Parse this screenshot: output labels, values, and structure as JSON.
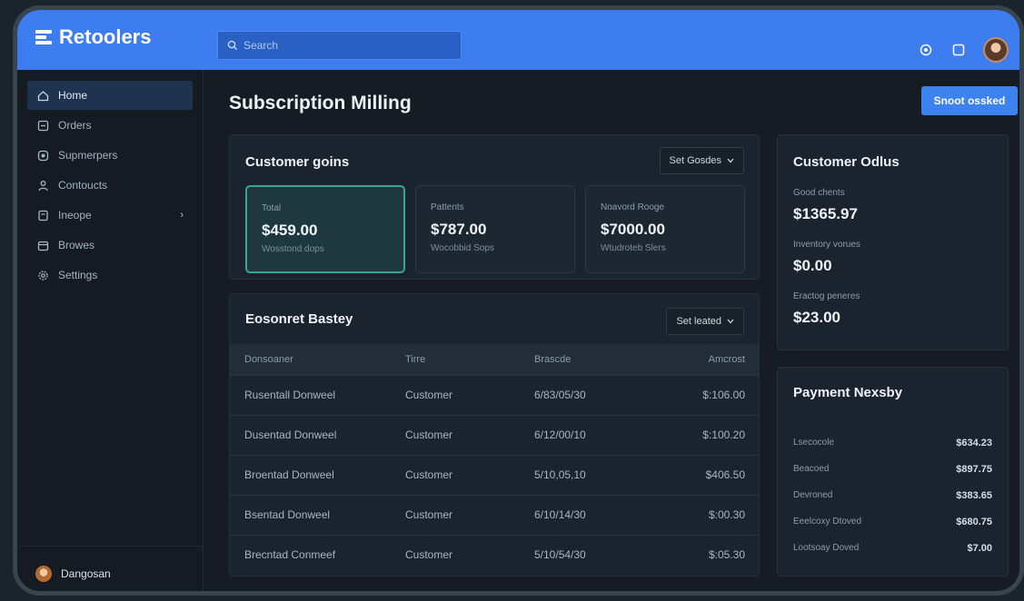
{
  "brand": {
    "name": "Retoolers",
    "icon": "menu-icon"
  },
  "search": {
    "placeholder": "Search",
    "icon": "search-icon"
  },
  "topbar_icons": [
    "settings-icon",
    "window-icon",
    "avatar"
  ],
  "sidebar": {
    "items": [
      {
        "label": "Home",
        "icon": "home-icon",
        "active": true
      },
      {
        "label": "Orders",
        "icon": "orders-icon"
      },
      {
        "label": "Supmerpers",
        "icon": "circle-icon"
      },
      {
        "label": "Contoucts",
        "icon": "user-icon"
      },
      {
        "label": "Ineope",
        "icon": "file-icon",
        "chevron": "›"
      },
      {
        "label": "Browes",
        "icon": "calendar-icon"
      },
      {
        "label": "Settings",
        "icon": "gear-icon"
      }
    ],
    "user": {
      "name": "Dangosan"
    }
  },
  "page": {
    "title": "Subscription Milling",
    "action_label": "Snoot ossked"
  },
  "customer_goals": {
    "title": "Customer goins",
    "select_label": "Set Gosdes",
    "stats": [
      {
        "label": "Total",
        "value": "$459.00",
        "sub": "Wosstond dops"
      },
      {
        "label": "Pattents",
        "value": "$787.00",
        "sub": "Wocobbid Sops"
      },
      {
        "label": "Noavord Rooge",
        "value": "$7000.00",
        "sub": "Wtudroteb Slers"
      }
    ]
  },
  "history": {
    "title": "Eosonret Bastey",
    "select_label": "Set leated",
    "columns": [
      "Donsoaner",
      "Tirre",
      "Brascde",
      "Amcrost"
    ],
    "rows": [
      [
        "Rusentall Donweel",
        "Customer",
        "6/83/05/30",
        "$:106.00"
      ],
      [
        "Dusentad Donweel",
        "Customer",
        "6/12/00/10",
        "$:100.20"
      ],
      [
        "Broentad Donweel",
        "Customer",
        "5/10,05,10",
        "$406.50"
      ],
      [
        "Bsentad Donweel",
        "Customer",
        "6/10/14/30",
        "$:00.30"
      ],
      [
        "Brecntad Conmeef",
        "Customer",
        "5/10/54/30",
        "$:05.30"
      ]
    ]
  },
  "customer_details": {
    "title": "Customer Odlus",
    "items": [
      {
        "label": "Good chents",
        "value": "$1365.97"
      },
      {
        "label": "Inventory vorues",
        "value": "$0.00"
      },
      {
        "label": "Eractog peneres",
        "value": "$23.00"
      }
    ]
  },
  "payment_history": {
    "title": "Payment Nexsby",
    "rows": [
      {
        "label": "Lsecocole",
        "value": "$634.23"
      },
      {
        "label": "Beacoed",
        "value": "$897.75"
      },
      {
        "label": "Devroned",
        "value": "$383.65"
      },
      {
        "label": "Eeelcoxy Dtoved",
        "value": "$680.75"
      },
      {
        "label": "Lootsoay Doved",
        "value": "$7.00"
      }
    ]
  }
}
